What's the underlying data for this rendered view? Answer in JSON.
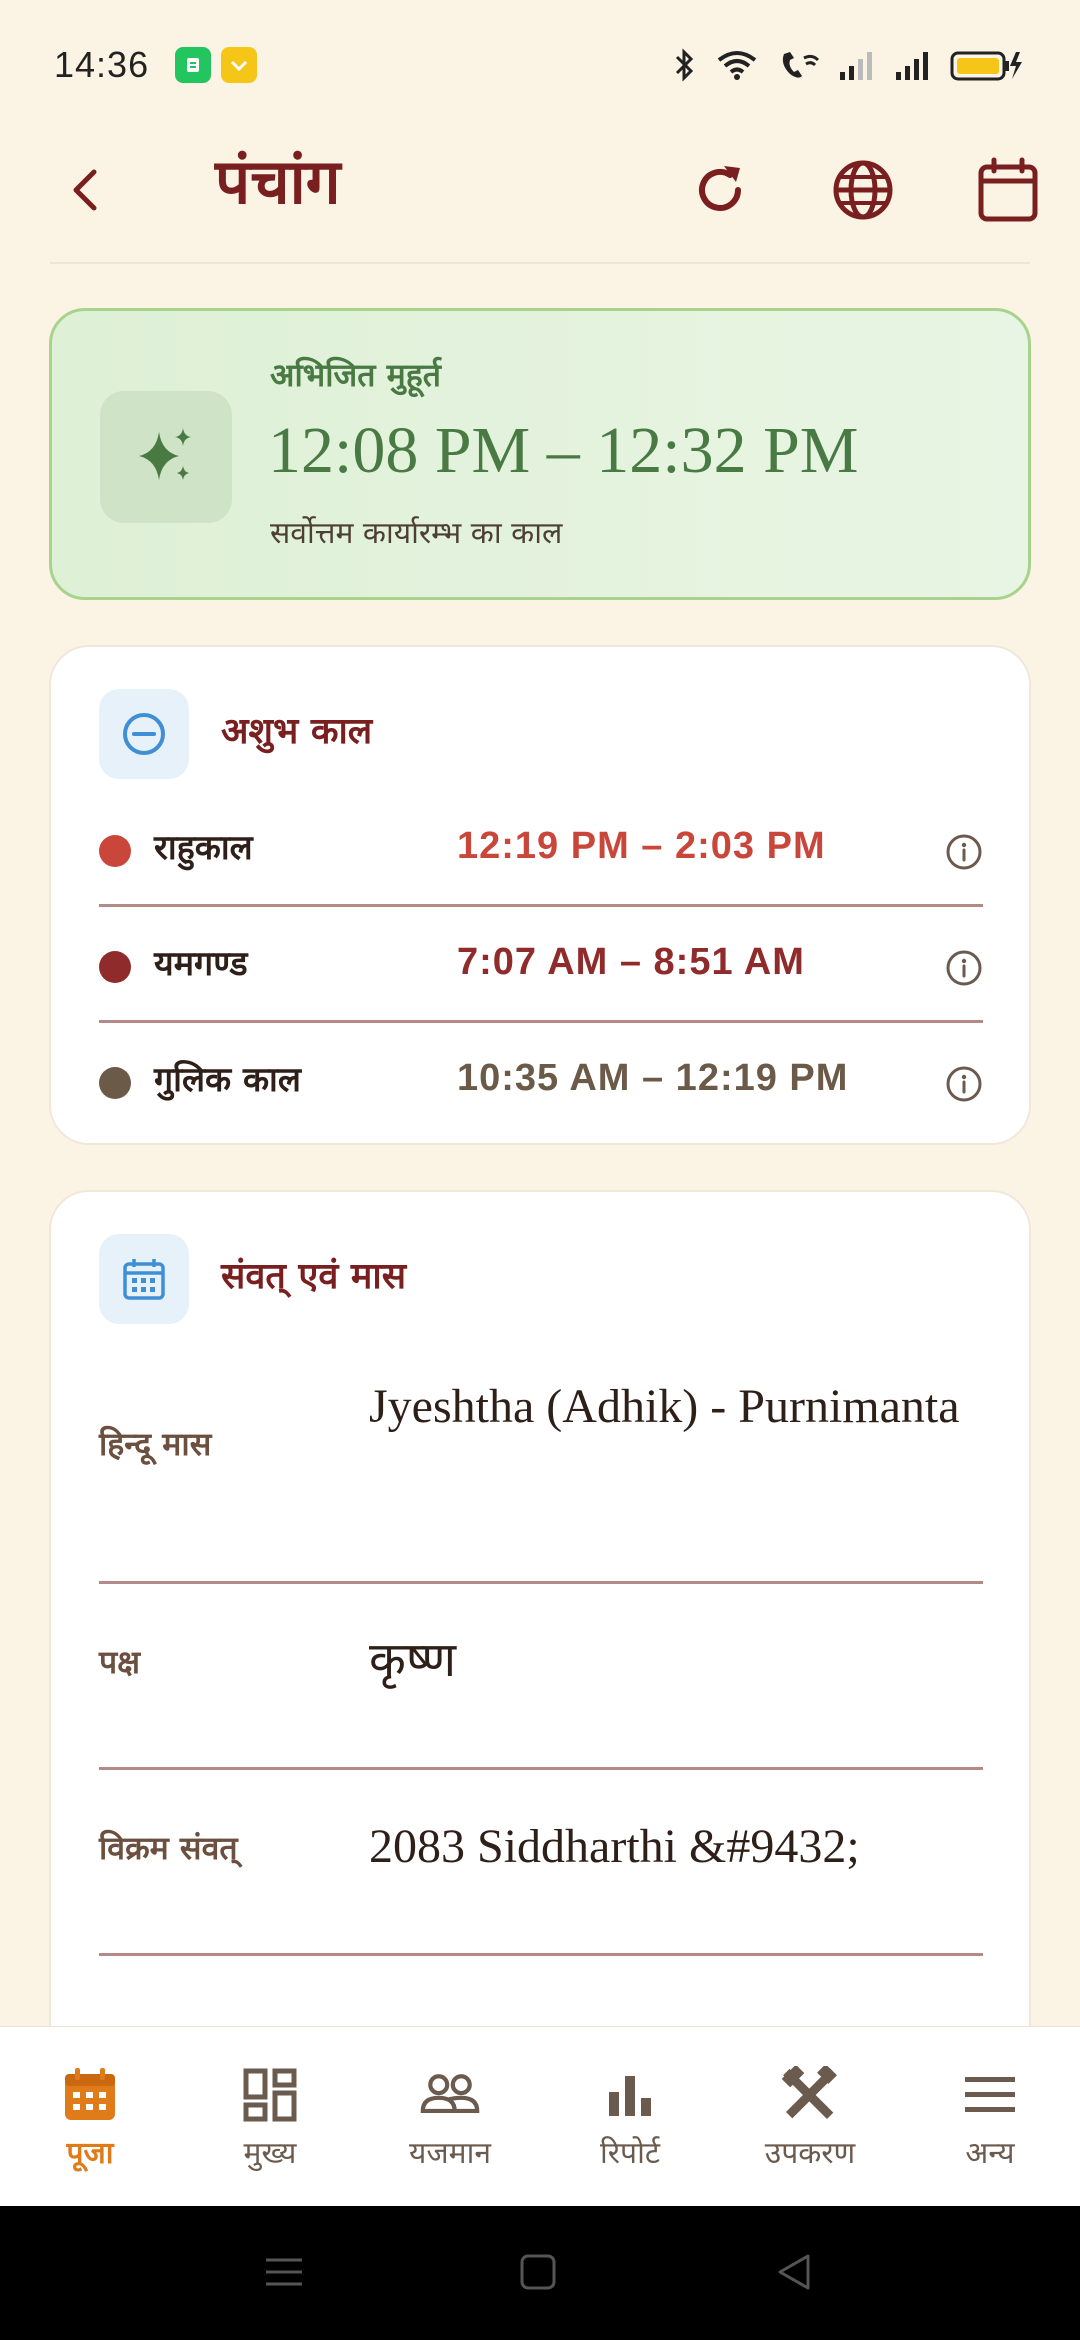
{
  "status_bar": {
    "time": "14:36"
  },
  "app_bar": {
    "title": "पंचांग"
  },
  "abhijit": {
    "label": "अभिजित मुहूर्त",
    "time": "12:08 PM – 12:32 PM",
    "subtitle": "सर्वोत्तम कार्यारम्भ का काल",
    "accent_color": "#4a7a44"
  },
  "ashubh": {
    "title": "अशुभ काल",
    "rows": [
      {
        "name": "राहुकाल",
        "range": "12:19 PM – 2:03 PM",
        "color": "#c9473a"
      },
      {
        "name": "यमगण्ड",
        "range": "7:07 AM – 8:51 AM",
        "color": "#8f2b2b"
      },
      {
        "name": "गुलिक काल",
        "range": "10:35 AM – 12:19 PM",
        "color": "#6b5a48"
      }
    ]
  },
  "samvat": {
    "title": "संवत् एवं मास",
    "rows": [
      {
        "label": "हिन्दू मास",
        "value": "Jyeshtha (Adhik) - Purnimanta"
      },
      {
        "label": "पक्ष",
        "value": "कृष्ण"
      },
      {
        "label": "विक्रम संवत्",
        "value": "2083 Siddharthi &#9432;"
      }
    ]
  },
  "bottom_nav": {
    "items": [
      {
        "label": "पूजा",
        "icon": "calendar-icon",
        "active": true
      },
      {
        "label": "मुख्य",
        "icon": "dashboard-icon"
      },
      {
        "label": "यजमान",
        "icon": "people-icon"
      },
      {
        "label": "रिपोर्ट",
        "icon": "bar-chart-icon"
      },
      {
        "label": "उपकरण",
        "icon": "tools-icon"
      },
      {
        "label": "अन्य",
        "icon": "menu-icon"
      }
    ]
  },
  "colors": {
    "brand": "#7a1f1f",
    "active_nav": "#e07b1a",
    "background": "#fbf3e4"
  }
}
